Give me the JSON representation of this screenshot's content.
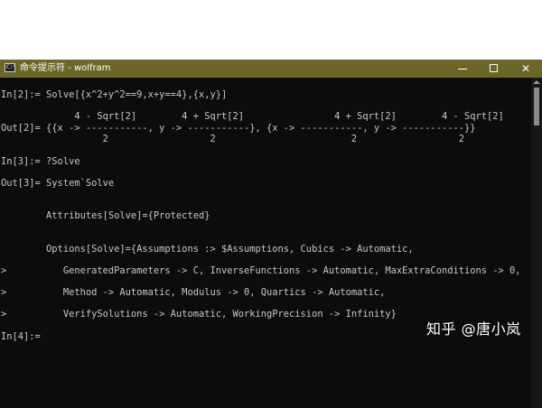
{
  "window": {
    "title": "命令提示符 - wolfram",
    "app_icon_text": "C:\\",
    "close_glyph": "✕"
  },
  "console": {
    "lines": [
      "In[2]:= Solve[{x^2+y^2==9,x+y==4},{x,y}]",
      "             4 - Sqrt[2]        4 + Sqrt[2]                4 + Sqrt[2]        4 - Sqrt[2]",
      "Out[2]= {{x -> -----------, y -> -----------}, {x -> -----------, y -> -----------}}",
      "                  2                  2                        2                  2",
      "In[3]:= ?Solve",
      "Out[3]= System`Solve",
      "        Attributes[Solve]={Protected}",
      "        Options[Solve]={Assumptions :> $Assumptions, Cubics -> Automatic,",
      ">          GeneratedParameters -> C, InverseFunctions -> Automatic, MaxExtraConditions -> 0,",
      ">          Method -> Automatic, Modulus -> 0, Quartics -> Automatic,",
      ">          VerifySolutions -> Automatic, WorkingPrecision -> Infinity}",
      "In[4]:="
    ]
  },
  "watermark": "知乎 @唐小岚",
  "colors": {
    "titlebar": "#6c6627",
    "console_bg": "#0c0c0c",
    "console_text": "#c8c8c8"
  }
}
